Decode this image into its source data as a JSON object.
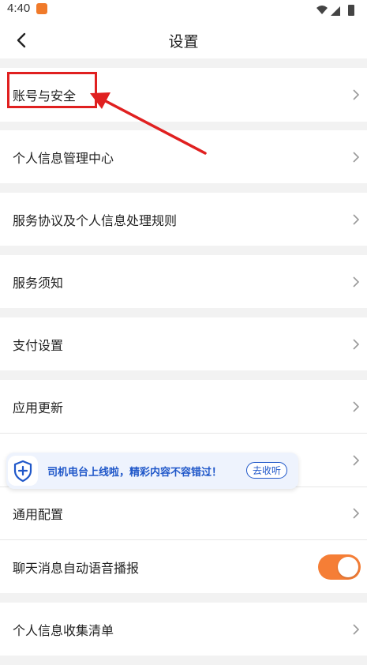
{
  "status_bar": {
    "time": "4:40",
    "app_badge_icon": "app-notification-icon"
  },
  "header": {
    "title": "设置",
    "back_icon": "chevron-left-icon"
  },
  "settings": {
    "items": [
      {
        "label": "账号与安全"
      },
      {
        "label": "个人信息管理中心"
      },
      {
        "label": "服务协议及个人信息处理规则"
      },
      {
        "label": "服务须知"
      },
      {
        "label": "支付设置"
      },
      {
        "label": "应用更新"
      },
      {
        "label": "通用配置"
      },
      {
        "label": "聊天消息自动语音播报",
        "toggle_on": true
      },
      {
        "label": "个人信息收集清单"
      }
    ]
  },
  "banner": {
    "text": "司机电台上线啦，精彩内容不容错过！",
    "button_label": "去收听",
    "icon": "shield-plus-icon"
  },
  "colors": {
    "accent": "#f57e36",
    "highlight": "#e02020",
    "banner_text": "#1f57c9"
  }
}
